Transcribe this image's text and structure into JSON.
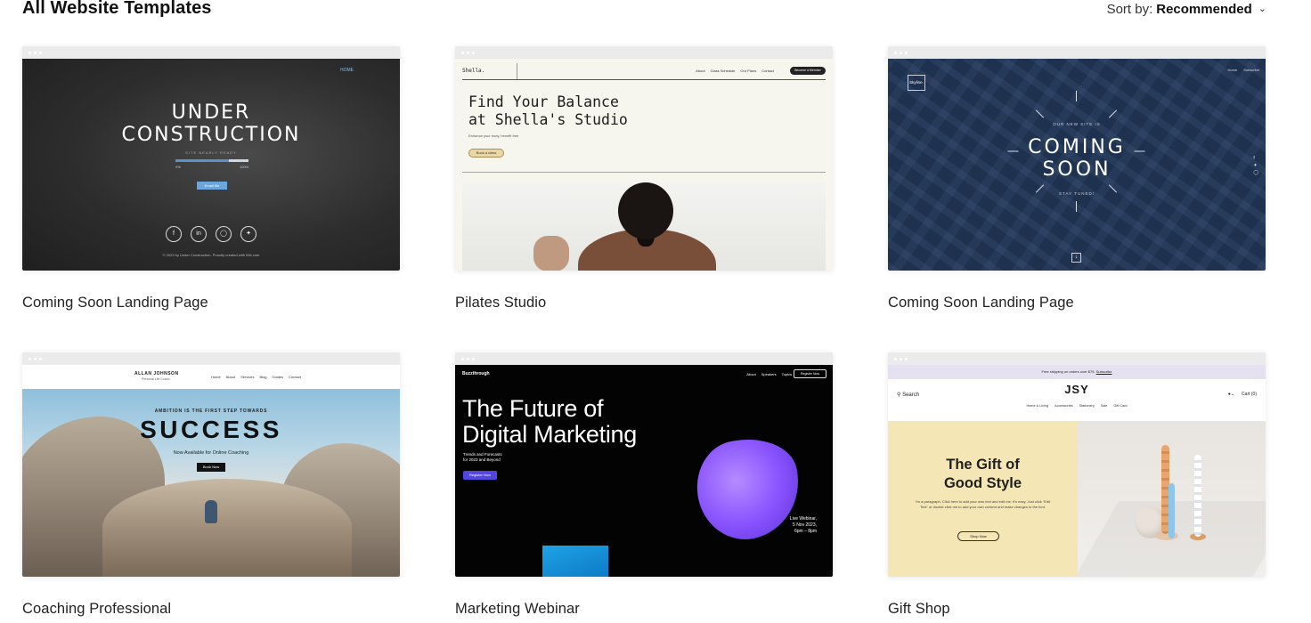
{
  "header": {
    "title": "All Website Templates",
    "sort_label": "Sort by:",
    "sort_value": "Recommended"
  },
  "templates": [
    {
      "caption": "Coming Soon Landing Page",
      "preview": {
        "nav": "HOME",
        "headline_line1": "UNDER",
        "headline_line2": "CONSTRUCTION",
        "subtitle": "SITE NEARLY READY",
        "progress_start": "0%",
        "progress_end": "100%",
        "button": "Email Me",
        "footer": "© 2023 by Under Construction. Proudly created with Wix.com"
      }
    },
    {
      "caption": "Pilates Studio",
      "preview": {
        "logo": "Shella.",
        "nav": [
          "About",
          "Class Schedule",
          "Our Plans",
          "Contact"
        ],
        "member_button": "Become a Member",
        "headline": "Find Your Balance\nat Shella's Studio",
        "subtitle": "Enhance your body, benefit free",
        "button": "Book a class"
      }
    },
    {
      "caption": "Coming Soon Landing Page",
      "preview": {
        "logo": "Skyline.",
        "nav": [
          "Home",
          "Subscribe"
        ],
        "pre": "OUR NEW SITE IS",
        "headline_line1": "COMING",
        "headline_line2": "SOON",
        "post": "STAY TUNED!"
      }
    },
    {
      "caption": "Coaching Professional",
      "preview": {
        "name": "ALLAN JOHNSON",
        "role": "Personal Life Coach",
        "nav": [
          "Home",
          "About",
          "Services",
          "Blog",
          "Guides",
          "Contact"
        ],
        "pre": "AMBITION IS THE FIRST STEP TOWARDS",
        "headline": "SUCCESS",
        "subtitle": "Now Available for Online Coaching",
        "button": "Book Now"
      }
    },
    {
      "caption": "Marketing Webinar",
      "preview": {
        "logo": "Buzzthrough",
        "nav": [
          "About",
          "Speakers",
          "Topics"
        ],
        "register_top": "Register Now",
        "headline_line1": "The Future of",
        "headline_line2": "Digital Marketing",
        "subtitle_line1": "Trends and Forecasts",
        "subtitle_line2": "for 2023 and Beyond",
        "button": "Register Now",
        "live_line1": "Live Webinar,",
        "live_line2": "5 Nov 2023,",
        "live_line3": "6pm – 8pm"
      }
    },
    {
      "caption": "Gift Shop",
      "preview": {
        "banner": "Free shipping on orders over $75.",
        "banner_link": "Subscribe",
        "search": "Search",
        "brand": "JSY",
        "nav": [
          "Home & Living",
          "Accessories",
          "Stationery",
          "Sale",
          "Gift Card"
        ],
        "cart": "Cart (0)",
        "headline_line1": "The Gift of",
        "headline_line2": "Good Style",
        "paragraph": "I'm a paragraph. Click here to add your own text and edit me. It's easy. Just click \"Edit Text\" or double click me to add your own content and make changes to the font.",
        "button": "Shop Now"
      }
    }
  ]
}
